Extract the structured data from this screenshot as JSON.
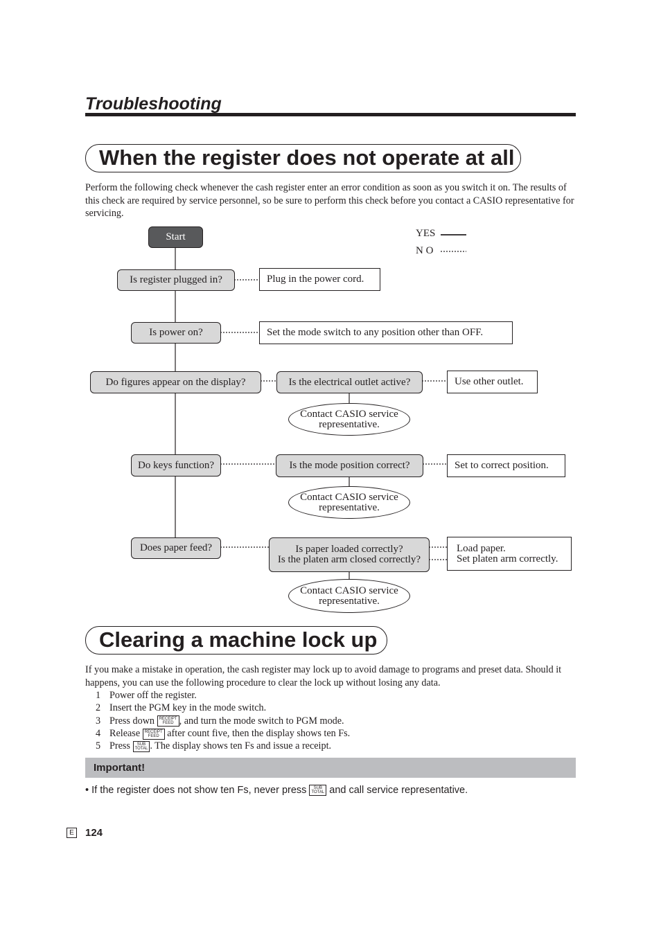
{
  "section_title": "Troubleshooting",
  "heading1": "When the register does not operate at all",
  "intro": "Perform the following check whenever the cash register enter an error condition as soon as you switch it on. The results of this check are required by service personnel, so be sure to perform this check before you contact a CASIO representative for servicing.",
  "legend": {
    "yes": "YES",
    "no": "N O"
  },
  "flow": {
    "start": "Start",
    "q1": "Is register plugged in?",
    "a1": "Plug in the power cord.",
    "q2": "Is power on?",
    "a2": "Set the mode switch to any position other than OFF.",
    "q3": "Do figures appear on the display?",
    "q3b": "Is the electrical outlet active?",
    "a3": "Use other outlet.",
    "contact1": "Contact CASIO service",
    "contact2": "representative.",
    "q4": "Do keys function?",
    "q4b": "Is the mode position correct?",
    "a4": "Set to correct position.",
    "q5": "Does paper feed?",
    "q5b1": "Is paper loaded correctly?",
    "q5b2": "Is the platen arm closed correctly?",
    "a5a": "Load paper.",
    "a5b": "Set platen arm correctly."
  },
  "heading2": "Clearing a machine lock up",
  "para2": "If you make a mistake in operation, the cash register may lock up to avoid damage to programs and preset data. Should it happens, you can use the following procedure to clear the lock up without losing any data.",
  "steps": [
    {
      "n": "1",
      "text": "Power off the register."
    },
    {
      "n": "2",
      "text": "Insert the PGM key in the mode switch."
    },
    {
      "n": "3",
      "pre": "Press down",
      "post": ", and turn the mode switch to PGM mode."
    },
    {
      "n": "4",
      "pre": "Release",
      "post": " after count five, then the display shows ten Fs."
    },
    {
      "n": "5",
      "pre": "Press",
      "post": ". The display shows ten Fs and issue a receipt."
    }
  ],
  "keys": {
    "receipt_top": "RECEIPT",
    "receipt_bottom": "FEED",
    "sub_top": "SUB",
    "sub_bottom": "TOTAL"
  },
  "important_label": "Important!",
  "important_pre": "• If the register does not show ten Fs, never press",
  "important_post": "and call service representative.",
  "footer": {
    "lang": "E",
    "page": "124"
  }
}
